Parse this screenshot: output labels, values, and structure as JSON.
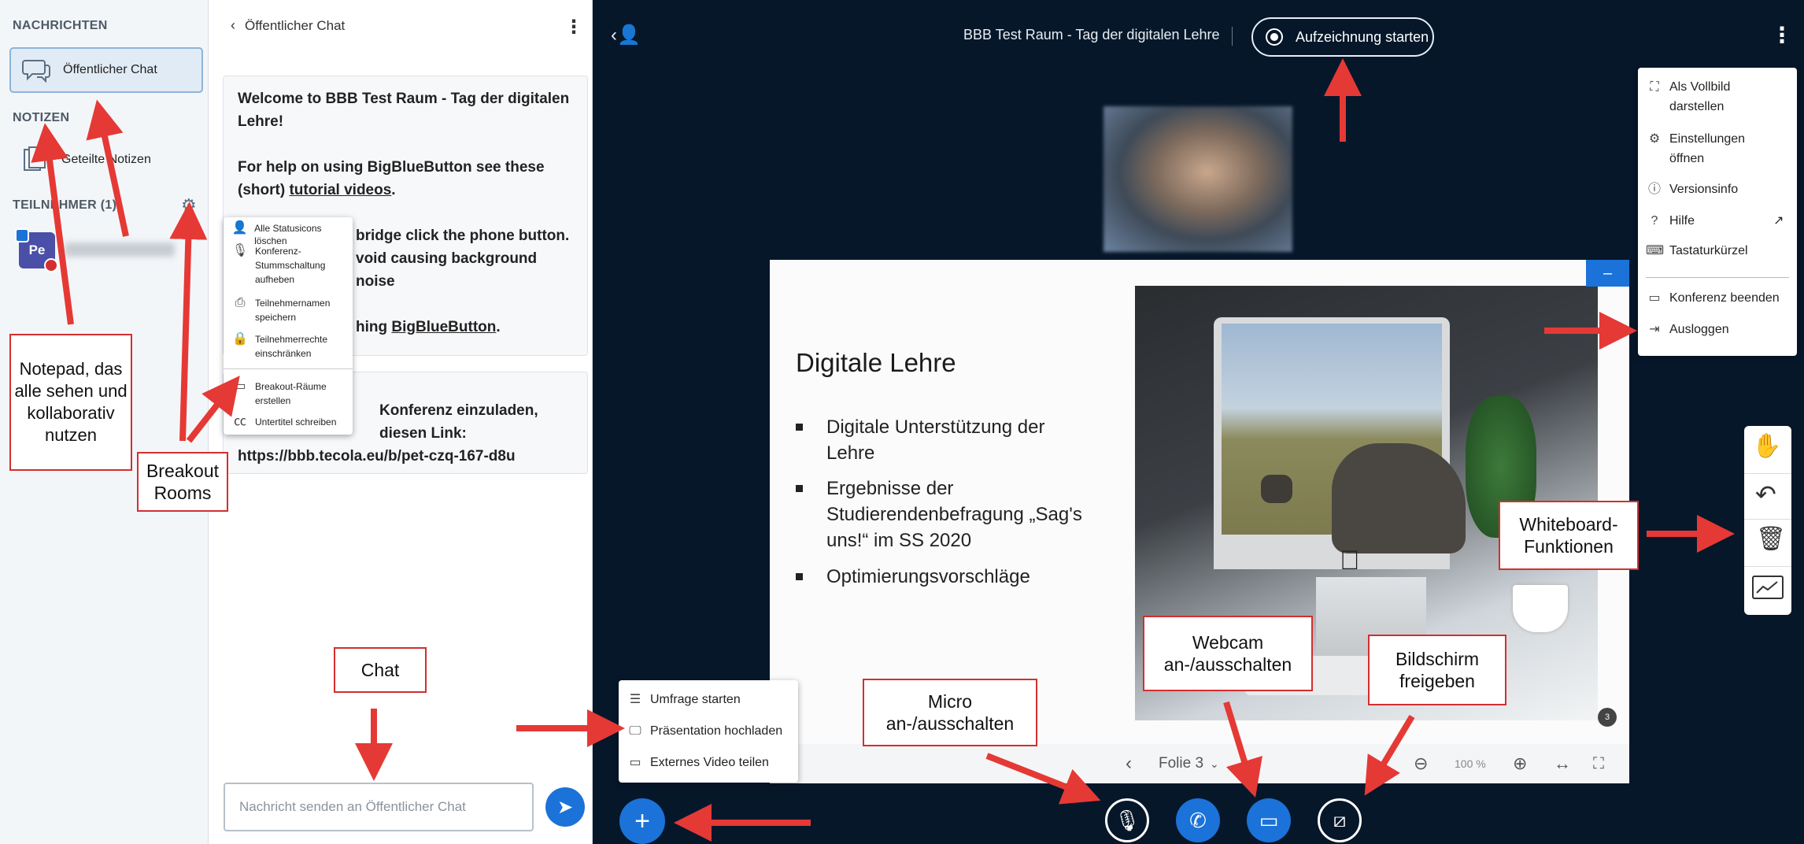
{
  "nav": {
    "messages_header": "NACHRICHTEN",
    "public_chat": "Öffentlicher Chat",
    "notes_header": "NOTIZEN",
    "shared_notes": "Geteilte Notizen",
    "participants_header": "TEILNEHMER (1)",
    "user_initials": "Pe"
  },
  "chat": {
    "back_title": "Öffentlicher Chat",
    "welcome_line1": "Welcome to BBB Test Raum - Tag der digitalen Lehre!",
    "welcome_line2a": "For help on using BigBlueButton see these (short) ",
    "welcome_link": "tutorial videos",
    "welcome_line2b": ".",
    "welcome_line3": "bridge click the phone button.",
    "welcome_line4": "void causing background noise",
    "welcome_line5a": "hing ",
    "welcome_line5_link": "BigBlueButton",
    "welcome_line5b": ".",
    "invite_line1": "Konferenz einzuladen,",
    "invite_line2": "diesen Link:",
    "invite_link": "https://bbb.tecola.eu/b/pet-czq-167-d8u",
    "input_placeholder": "Nachricht senden an Öffentlicher Chat"
  },
  "participant_menu": [
    {
      "icon": "person-icon",
      "label": "Alle Statusicons löschen"
    },
    {
      "icon": "mic-icon",
      "label": "Konferenz-Stummschaltung aufheben"
    },
    {
      "icon": "save-icon",
      "label": "Teilnehmernamen speichern"
    },
    {
      "icon": "lock-icon",
      "label": "Teilnehmerrechte einschränken"
    },
    {
      "icon": "breakout-icon",
      "label": "Breakout-Räume erstellen"
    },
    {
      "icon": "caption-icon",
      "label": "Untertitel schreiben"
    }
  ],
  "main": {
    "room_title": "BBB Test Raum - Tag der digitalen Lehre",
    "record_label": "Aufzeichnung starten"
  },
  "options_menu": [
    {
      "icon": "fullscreen-icon",
      "label": "Als Vollbild darstellen"
    },
    {
      "icon": "gear-icon",
      "label": "Einstellungen öffnen"
    },
    {
      "icon": "info-icon",
      "label": "Versionsinfo"
    },
    {
      "icon": "help-icon",
      "label": "Hilfe"
    },
    {
      "icon": "keyboard-icon",
      "label": "Tastaturkürzel"
    },
    {
      "icon": "end-conference-icon",
      "label": "Konferenz beenden"
    },
    {
      "icon": "logout-icon",
      "label": "Ausloggen"
    }
  ],
  "slide": {
    "title": "Digitale Lehre",
    "bullets": [
      "Digitale Unterstützung der Lehre",
      "Ergebnisse der Studierendenbefragung „Sag's uns!“ im SS 2020",
      "Optimierungsvorschläge"
    ],
    "page_badge": "3",
    "page_label": "Folie 3",
    "zoom": "100 %"
  },
  "action_menu": [
    {
      "icon": "poll-icon",
      "label": "Umfrage starten"
    },
    {
      "icon": "presentation-icon",
      "label": "Präsentation hochladen"
    },
    {
      "icon": "video-icon",
      "label": "Externes Video teilen"
    }
  ],
  "annotations": {
    "notepad": "Notepad, das alle sehen und kollaborativ nutzen",
    "breakout": "Breakout Rooms",
    "chat": "Chat",
    "micro": "Micro an-/ausschalten",
    "webcam": "Webcam an-/ausschalten",
    "screen": "Bildschirm freigeben",
    "whiteboard": "Whiteboard-Funktionen"
  },
  "colors": {
    "main_bg": "#06172a",
    "accent_blue": "#1b72d8",
    "annotation_red": "#e53935"
  }
}
